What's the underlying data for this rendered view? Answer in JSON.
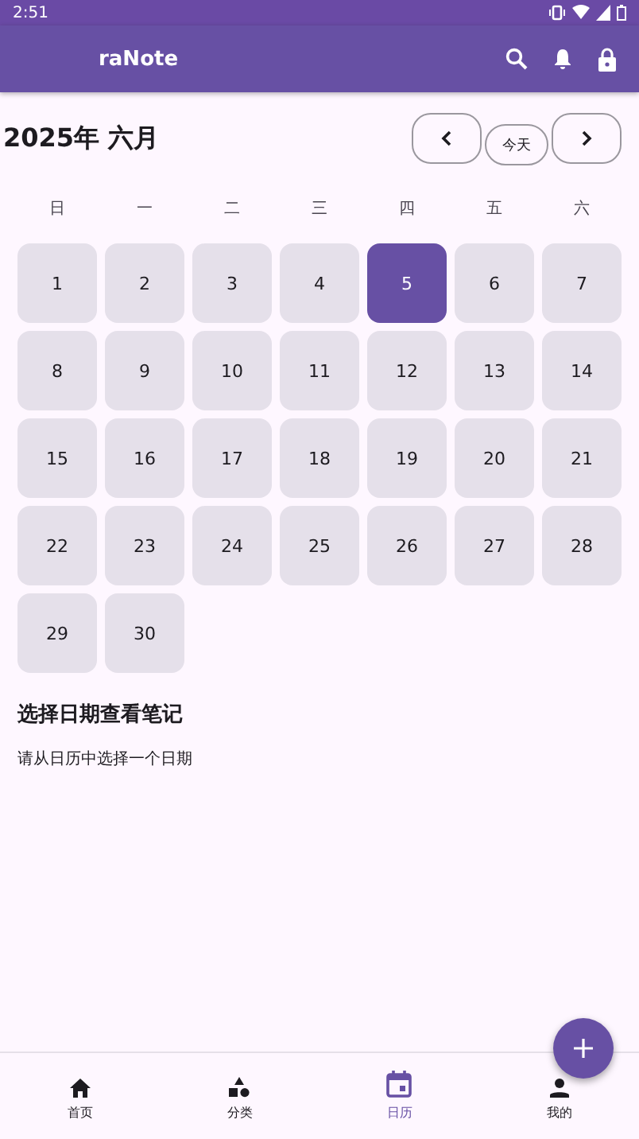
{
  "status_bar": {
    "time": "2:51"
  },
  "app_bar": {
    "title": "raNote"
  },
  "calendar": {
    "month_label": "2025年 六月",
    "today_button": "今天",
    "weekdays": [
      "日",
      "一",
      "二",
      "三",
      "四",
      "五",
      "六"
    ],
    "days": [
      {
        "label": "1",
        "selected": false
      },
      {
        "label": "2",
        "selected": false
      },
      {
        "label": "3",
        "selected": false
      },
      {
        "label": "4",
        "selected": false
      },
      {
        "label": "5",
        "selected": true
      },
      {
        "label": "6",
        "selected": false
      },
      {
        "label": "7",
        "selected": false
      },
      {
        "label": "8",
        "selected": false
      },
      {
        "label": "9",
        "selected": false
      },
      {
        "label": "10",
        "selected": false
      },
      {
        "label": "11",
        "selected": false
      },
      {
        "label": "12",
        "selected": false
      },
      {
        "label": "13",
        "selected": false
      },
      {
        "label": "14",
        "selected": false
      },
      {
        "label": "15",
        "selected": false
      },
      {
        "label": "16",
        "selected": false
      },
      {
        "label": "17",
        "selected": false
      },
      {
        "label": "18",
        "selected": false
      },
      {
        "label": "19",
        "selected": false
      },
      {
        "label": "20",
        "selected": false
      },
      {
        "label": "21",
        "selected": false
      },
      {
        "label": "22",
        "selected": false
      },
      {
        "label": "23",
        "selected": false
      },
      {
        "label": "24",
        "selected": false
      },
      {
        "label": "25",
        "selected": false
      },
      {
        "label": "26",
        "selected": false
      },
      {
        "label": "27",
        "selected": false
      },
      {
        "label": "28",
        "selected": false
      },
      {
        "label": "29",
        "selected": false
      },
      {
        "label": "30",
        "selected": false
      }
    ]
  },
  "notes": {
    "heading": "选择日期查看笔记",
    "hint": "请从日历中选择一个日期"
  },
  "bottom_nav": [
    {
      "label": "首页",
      "kind": "home",
      "selected": false
    },
    {
      "label": "分类",
      "kind": "shapes",
      "selected": false
    },
    {
      "label": "日历",
      "kind": "calendar",
      "selected": true
    },
    {
      "label": "我的",
      "kind": "person",
      "selected": false
    }
  ]
}
